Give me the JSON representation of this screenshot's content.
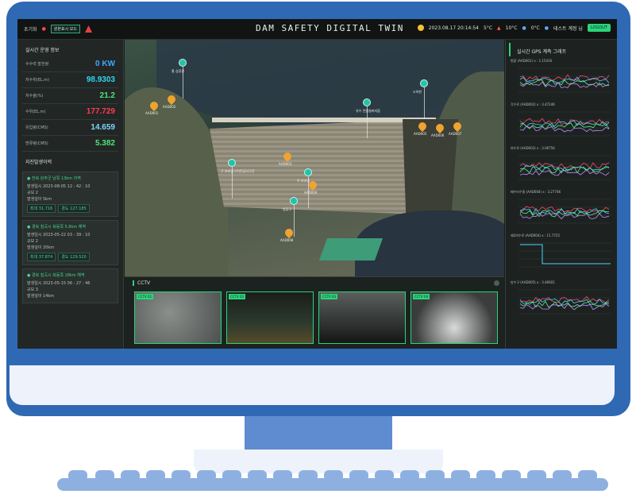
{
  "topbar": {
    "app_title": "DAM SAFETY DIGITAL TWIN",
    "left_label": "초기화",
    "left_red": "●",
    "left_btn": "원본표시 모드",
    "datetime": "2023.08.17 20:14:54",
    "temp1": "5°C",
    "temp2": "10°C",
    "temp3": "0°C",
    "user": "테스트 계정 님",
    "exit_label": "LOGOUT"
  },
  "left_panel": {
    "section_title": "실시간 운영 정보",
    "metrics": [
      {
        "label": "수수력 발전량",
        "value": "0 KW",
        "color": "#3aa9ff"
      },
      {
        "label": "저수위(EL.m)",
        "value": "98.9303",
        "color": "#2fd6f2"
      },
      {
        "label": "저수율(%)",
        "value": "21.2",
        "color": "#4fe37a"
      },
      {
        "label": "수위(EL.m)",
        "value": "177.729",
        "color": "#ff3b50"
      },
      {
        "label": "유입량(CMS)",
        "value": "14.659",
        "color": "#7fd4ff"
      },
      {
        "label": "방류량(CMS)",
        "value": "5.382",
        "color": "#4fe37a"
      }
    ],
    "eq_title": "지진발생이력",
    "eq_cards": [
      {
        "title": "● 전북 완주군 남쪽 13km 지역",
        "time": "2023-08-05 12 : 42 : 10",
        "magnitude": "2",
        "depth": "5km",
        "tag1": "최대 31.716",
        "tag2": "경도 127.185"
      },
      {
        "title": "● 경북 칠곡시 북동쪽 5.8km 해역",
        "time": "2023-05-22 03 : 39 : 10",
        "magnitude": "2",
        "depth": "20km",
        "tag1": "최대 37.874",
        "tag2": "경도 129.520"
      },
      {
        "title": "● 경북 칠곡시 북동쪽 18km 해역",
        "time": "2023-05-15 06 : 27 : 46",
        "magnitude": "3",
        "depth": "14km",
        "tag1": "",
        "tag2": ""
      }
    ],
    "row_labels": {
      "time": "발생일시",
      "magnitude": "규모",
      "depth": "발생깊이"
    }
  },
  "view": {
    "pins": [
      {
        "label": "AAD001"
      },
      {
        "label": "AAD002"
      },
      {
        "label": "AAD003"
      },
      {
        "label": "AAD004"
      },
      {
        "label": "AAD005"
      },
      {
        "label": "AAD006"
      },
      {
        "label": "AAD007"
      },
      {
        "label": "AAD008"
      }
    ],
    "cams": [
      {
        "label": "홍 상류관"
      },
      {
        "label": "유수 전원설비지점"
      },
      {
        "label": "소하천"
      },
      {
        "label": "구 보조댐 (우안)공사구간"
      },
      {
        "label": "주 보조댐"
      },
      {
        "label": "방류구"
      }
    ]
  },
  "cctv": {
    "title": "CCTV",
    "feeds": [
      "CCTV 01",
      "CCTV 02",
      "CCTV 03",
      "CCTV 04"
    ]
  },
  "right_panel": {
    "title": "실시간 GPS 계측 그래프",
    "graphs": [
      {
        "label": "편광 (AAD001) x : 1.15416"
      },
      {
        "label": "각수로 (AAD002) x : 3.47246"
      },
      {
        "label": "여수로 (AAD003) x : 3.06756"
      },
      {
        "label": "배수터수중 (AAD004) x : 3.27746"
      },
      {
        "label": "제2여수로 (AAD004) x : 11.7725"
      },
      {
        "label": "방수구 (AAD005) x : 3.46601"
      }
    ]
  }
}
